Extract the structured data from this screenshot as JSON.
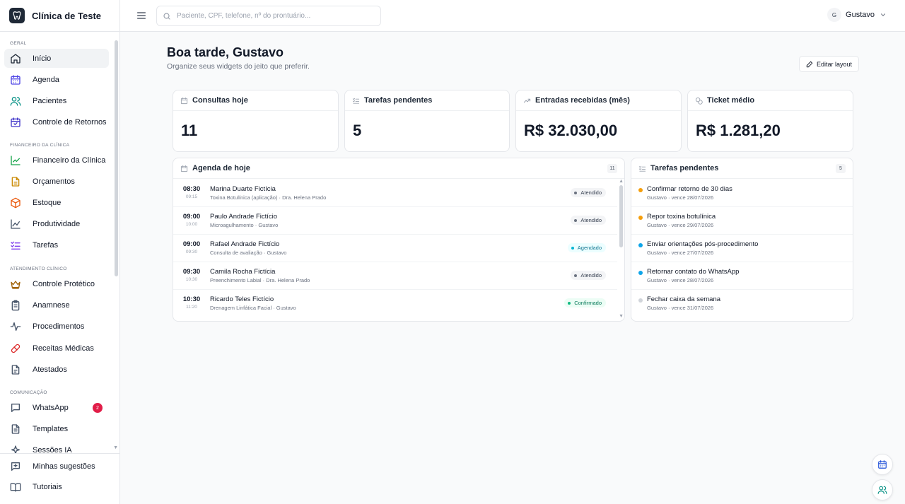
{
  "brand": {
    "name": "Clínica de Teste"
  },
  "search": {
    "placeholder": "Paciente, CPF, telefone, nº do prontuário..."
  },
  "user": {
    "initial": "G",
    "name": "Gustavo"
  },
  "sidebar": {
    "sections": {
      "geral": "GERAL",
      "financeiro": "FINANCEIRO DA CLÍNICA",
      "atendimento": "ATENDIMENTO CLÍNICO",
      "comunicacao": "COMUNICAÇÃO"
    },
    "items": [
      {
        "label": "Início",
        "icon": "home-icon"
      },
      {
        "label": "Agenda",
        "icon": "calendar-icon"
      },
      {
        "label": "Pacientes",
        "icon": "users-icon"
      },
      {
        "label": "Controle de Retornos",
        "icon": "calendar-check-icon"
      },
      {
        "label": "Financeiro da Clínica",
        "icon": "trend-icon"
      },
      {
        "label": "Orçamentos",
        "icon": "file-text-icon"
      },
      {
        "label": "Estoque",
        "icon": "package-icon"
      },
      {
        "label": "Produtividade",
        "icon": "line-chart-icon"
      },
      {
        "label": "Tarefas",
        "icon": "list-check-icon"
      },
      {
        "label": "Controle Protético",
        "icon": "crown-icon"
      },
      {
        "label": "Anamnese",
        "icon": "clipboard-icon"
      },
      {
        "label": "Procedimentos",
        "icon": "activity-icon"
      },
      {
        "label": "Receitas Médicas",
        "icon": "pill-icon"
      },
      {
        "label": "Atestados",
        "icon": "document-icon"
      },
      {
        "label": "WhatsApp",
        "icon": "message-icon",
        "badge": "2"
      },
      {
        "label": "Templates",
        "icon": "template-icon"
      },
      {
        "label": "Sessões IA",
        "icon": "sparkle-icon"
      }
    ],
    "bottom": [
      {
        "label": "Minhas sugestões",
        "icon": "suggestion-icon"
      },
      {
        "label": "Tutoriais",
        "icon": "book-icon"
      }
    ]
  },
  "main": {
    "greeting": "Boa tarde, Gustavo",
    "subtitle": "Organize seus widgets do jeito que preferir.",
    "edit_layout": "Editar layout"
  },
  "stats": [
    {
      "title": "Consultas hoje",
      "value": "11"
    },
    {
      "title": "Tarefas pendentes",
      "value": "5"
    },
    {
      "title": "Entradas recebidas (mês)",
      "value": "R$ 32.030,00"
    },
    {
      "title": "Ticket médio",
      "value": "R$ 1.281,20"
    }
  ],
  "agenda": {
    "title": "Agenda de hoje",
    "count": "11",
    "items": [
      {
        "start": "08:30",
        "end": "09:15",
        "name": "Marina Duarte Fictícia",
        "detail": "Toxina Botulínica (aplicação) · Dra. Helena Prado",
        "status": "Atendido"
      },
      {
        "start": "09:00",
        "end": "10:00",
        "name": "Paulo Andrade Fictício",
        "detail": "Microagulhamento · Gustavo",
        "status": "Atendido"
      },
      {
        "start": "09:00",
        "end": "09:30",
        "name": "Rafael Andrade Fictício",
        "detail": "Consulta de avaliação · Gustavo",
        "status": "Agendado"
      },
      {
        "start": "09:30",
        "end": "10:30",
        "name": "Camila Rocha Fictícia",
        "detail": "Preenchimento Labial · Dra. Helena Prado",
        "status": "Atendido"
      },
      {
        "start": "10:30",
        "end": "11:20",
        "name": "Ricardo Teles Fictício",
        "detail": "Drenagem Linfática Facial · Gustavo",
        "status": "Confirmado"
      }
    ]
  },
  "tasks": {
    "title": "Tarefas pendentes",
    "count": "5",
    "items": [
      {
        "title": "Confirmar retorno de 30 dias",
        "meta": "Gustavo · vence 28/07/2026",
        "color": "#f59e0b"
      },
      {
        "title": "Repor toxina botulínica",
        "meta": "Gustavo · vence 29/07/2026",
        "color": "#f59e0b"
      },
      {
        "title": "Enviar orientações pós-procedimento",
        "meta": "Gustavo · vence 27/07/2026",
        "color": "#0ea5e9"
      },
      {
        "title": "Retornar contato do WhatsApp",
        "meta": "Gustavo · vence 28/07/2026",
        "color": "#0ea5e9"
      },
      {
        "title": "Fechar caixa da semana",
        "meta": "Gustavo · vence 31/07/2026",
        "color": "#d1d5db"
      }
    ]
  },
  "colors": {
    "accent": "#0e7490",
    "badge": "#e11d48"
  }
}
